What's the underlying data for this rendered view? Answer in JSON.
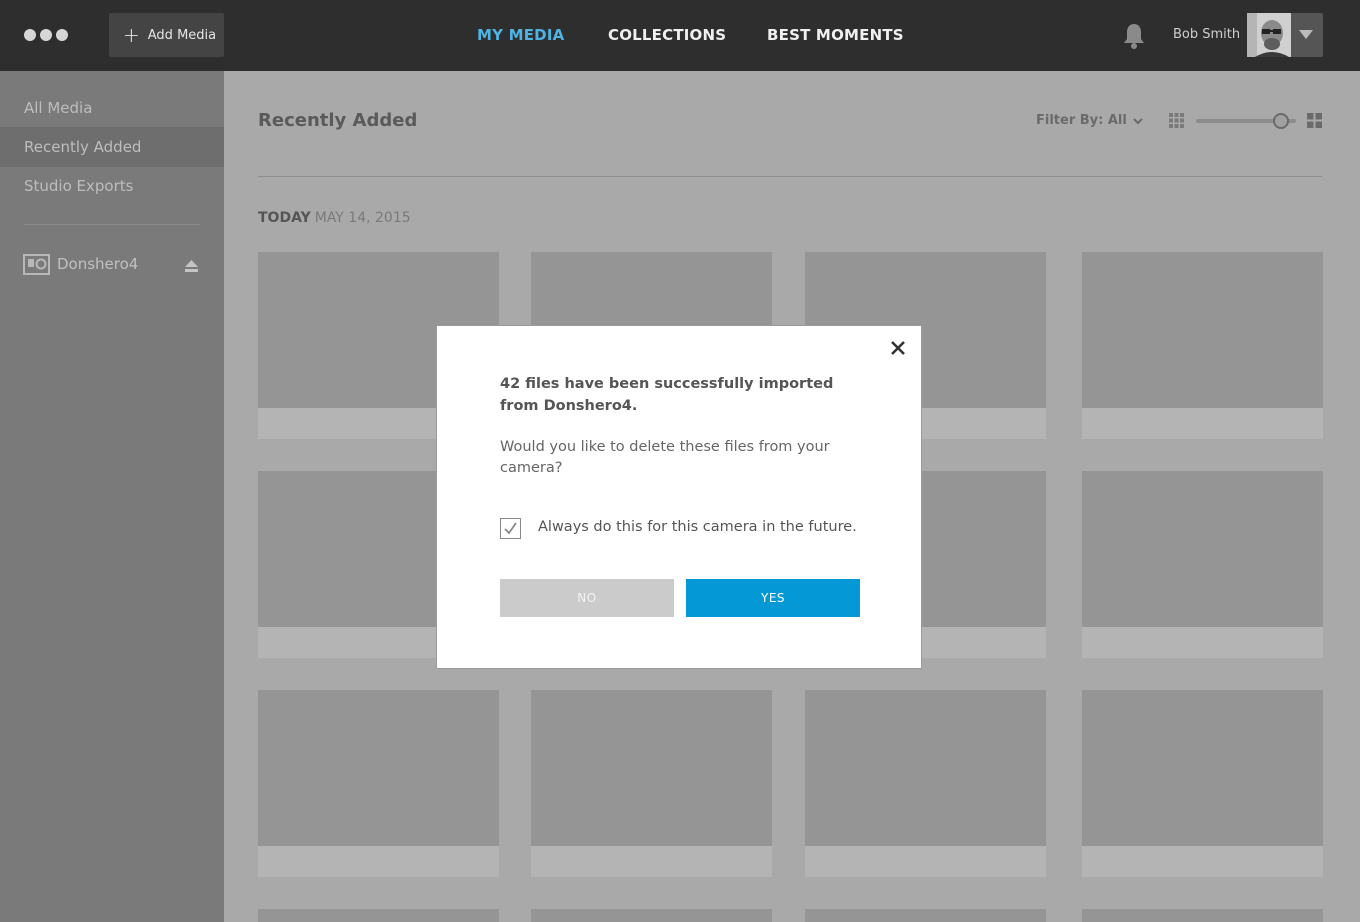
{
  "header": {
    "add_media_label": "Add Media",
    "tabs": [
      {
        "label": "MY MEDIA",
        "active": true
      },
      {
        "label": "COLLECTIONS",
        "active": false
      },
      {
        "label": "BEST MOMENTS",
        "active": false
      }
    ],
    "username": "Bob Smith",
    "accent_color": "#4fb3e3"
  },
  "sidebar": {
    "items": [
      {
        "label": "All Media",
        "active": false
      },
      {
        "label": "Recently Added",
        "active": true
      },
      {
        "label": "Studio Exports",
        "active": false
      }
    ],
    "device": {
      "label": "Donshero4",
      "icon": "camera-icon"
    }
  },
  "main": {
    "title": "Recently Added",
    "filter_label": "Filter By: All",
    "zoom_level": 0.85,
    "date_head": {
      "today": "TODAY",
      "date": "MAY 14, 2015"
    }
  },
  "modal": {
    "message_primary": "42 files have been successfully imported from Donshero4.",
    "message_secondary": "Would you like to delete these files from your camera?",
    "checkbox_label": "Always do this for this camera in the future.",
    "checkbox_checked": true,
    "no_label": "NO",
    "yes_label": "YES",
    "yes_color": "#0598d7"
  }
}
